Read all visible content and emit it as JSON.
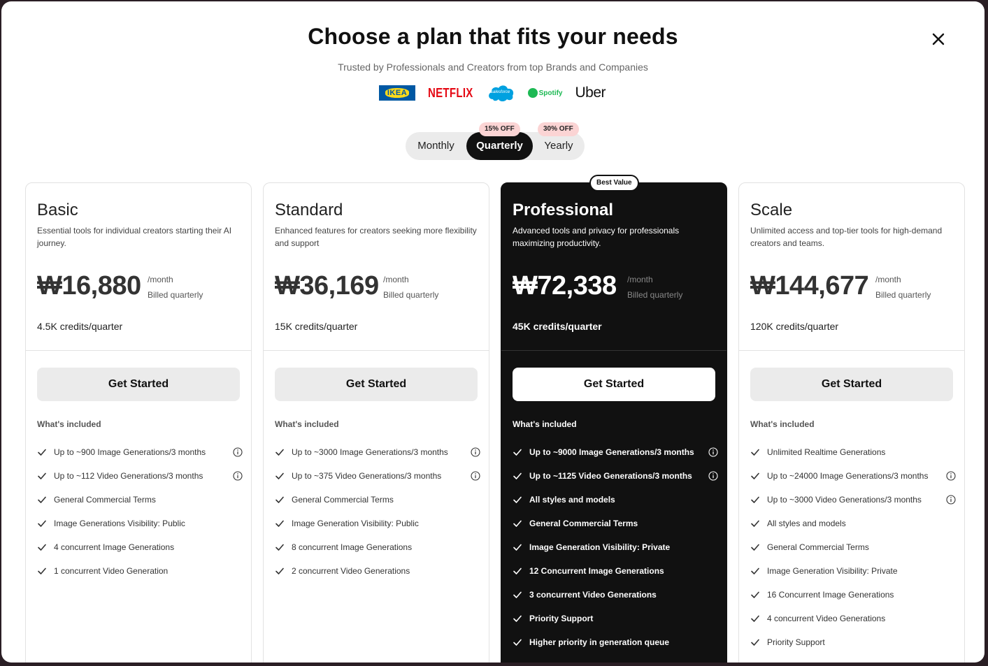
{
  "header": {
    "title": "Choose a plan that fits your needs",
    "subtitle": "Trusted by Professionals and Creators from top Brands and Companies",
    "close_icon": "close-icon"
  },
  "brands": {
    "ikea": "IKEA",
    "netflix": "NETFLIX",
    "salesforce": "salesforce",
    "spotify": "Spotify",
    "uber": "Uber"
  },
  "billing_toggle": {
    "monthly": "Monthly",
    "quarterly": "Quarterly",
    "yearly": "Yearly",
    "selected": "Quarterly",
    "quarterly_discount": "15% OFF",
    "yearly_discount": "30% OFF"
  },
  "best_value_badge": "Best Value",
  "colors": {
    "dark_card": "#111111",
    "discount_badge": "#fbd4d4",
    "accent_button": "#ebebeb"
  },
  "plans": [
    {
      "name": "Basic",
      "description": "Essential tools for individual creators starting their AI journey.",
      "price": "₩16,880",
      "per": "/month",
      "billed": "Billed quarterly",
      "credits": "4.5K credits/quarter",
      "cta": "Get Started",
      "included_label": "What's included",
      "features": [
        {
          "text": "Up to ~900 Image Generations/3 months",
          "info": true
        },
        {
          "text": "Up to ~112 Video Generations/3 months",
          "info": true
        },
        {
          "text": "General Commercial Terms",
          "info": false
        },
        {
          "text": "Image Generations Visibility: Public",
          "info": false
        },
        {
          "text": "4 concurrent Image Generations",
          "info": false
        },
        {
          "text": "1 concurrent Video Generation",
          "info": false
        }
      ]
    },
    {
      "name": "Standard",
      "description": "Enhanced features for creators seeking more flexibility and support",
      "price": "₩36,169",
      "per": "/month",
      "billed": "Billed quarterly",
      "credits": "15K credits/quarter",
      "cta": "Get Started",
      "included_label": "What's included",
      "features": [
        {
          "text": "Up to ~3000 Image Generations/3 months",
          "info": true
        },
        {
          "text": "Up to ~375 Video Generations/3 months",
          "info": true
        },
        {
          "text": "General Commercial Terms",
          "info": false
        },
        {
          "text": "Image Generation Visibility: Public",
          "info": false
        },
        {
          "text": "8 concurrent Image Generations",
          "info": false
        },
        {
          "text": "2 concurrent Video Generations",
          "info": false
        }
      ]
    },
    {
      "name": "Professional",
      "description": "Advanced tools and privacy for professionals maximizing productivity.",
      "price": "₩72,338",
      "per": "/month",
      "billed": "Billed quarterly",
      "credits": "45K credits/quarter",
      "cta": "Get Started",
      "included_label": "What's included",
      "features": [
        {
          "text": "Up to ~9000 Image Generations/3 months",
          "info": true
        },
        {
          "text": "Up to ~1125 Video Generations/3 months",
          "info": true
        },
        {
          "text": "All styles and models",
          "info": false
        },
        {
          "text": "General Commercial Terms",
          "info": false
        },
        {
          "text": "Image Generation Visibility: Private",
          "info": false
        },
        {
          "text": "12 Concurrent Image Generations",
          "info": false
        },
        {
          "text": "3 concurrent Video Generations",
          "info": false
        },
        {
          "text": "Priority Support",
          "info": false
        },
        {
          "text": "Higher priority in generation queue",
          "info": false
        }
      ]
    },
    {
      "name": "Scale",
      "description": "Unlimited access and top-tier tools for high-demand creators and teams.",
      "price": "₩144,677",
      "per": "/month",
      "billed": "Billed quarterly",
      "credits": "120K credits/quarter",
      "cta": "Get Started",
      "included_label": "What's included",
      "features": [
        {
          "text": "Unlimited Realtime Generations",
          "info": false
        },
        {
          "text": "Up to ~24000 Image Generations/3 months",
          "info": true
        },
        {
          "text": "Up to ~3000 Video Generations/3 months",
          "info": true
        },
        {
          "text": "All styles and models",
          "info": false
        },
        {
          "text": "General Commercial Terms",
          "info": false
        },
        {
          "text": "Image Generation Visibility: Private",
          "info": false
        },
        {
          "text": "16 Concurrent Image Generations",
          "info": false
        },
        {
          "text": "4 concurrent Video Generations",
          "info": false
        },
        {
          "text": "Priority Support",
          "info": false
        }
      ]
    }
  ]
}
